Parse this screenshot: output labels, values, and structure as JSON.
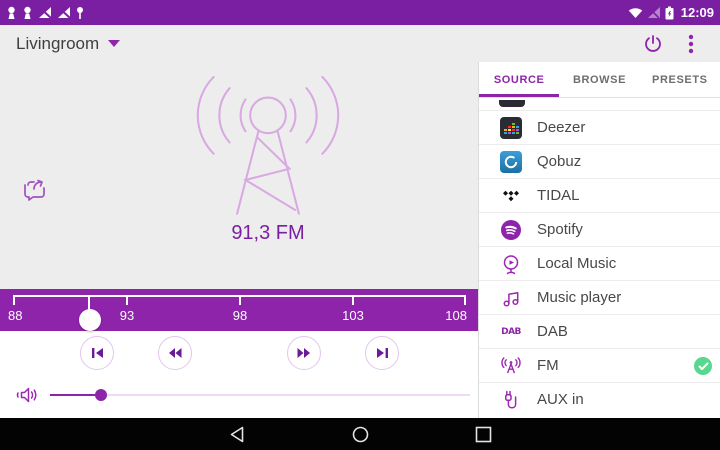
{
  "colors": {
    "status_bar": "#7B1FA2",
    "accent": "#8E24AA",
    "icon_purple": "#9C27B0",
    "antenna": "#D9A9E2",
    "selected_check": "#57D78F"
  },
  "status_bar": {
    "time": "12:09",
    "left_icons": [
      "app-notification-icon",
      "app-notification-icon",
      "wifi-off-notification-icon",
      "wifi-off-notification-icon",
      "pin-notification-icon"
    ],
    "right_icons": [
      "wifi-icon",
      "cell-signal-off-icon",
      "battery-icon"
    ]
  },
  "app_bar": {
    "room_name": "Livingroom",
    "actions": [
      "power-icon",
      "overflow-menu-icon"
    ]
  },
  "player": {
    "station_label": "91,3 FM",
    "frequency_value": 91.3,
    "frequency_min": 88,
    "frequency_max": 108,
    "frequency_ticks": [
      "88",
      "93",
      "98",
      "103",
      "108"
    ],
    "transport_buttons": [
      "skip-previous",
      "rewind",
      "fast-forward",
      "skip-next"
    ],
    "volume_level_percent": 12
  },
  "tabs": [
    {
      "label": "SOURCE",
      "active": true
    },
    {
      "label": "BROWSE",
      "active": false
    },
    {
      "label": "PRESETS",
      "active": false
    }
  ],
  "source_list": [
    {
      "label": "Deezer",
      "icon": "deezer-icon",
      "selected": false
    },
    {
      "label": "Qobuz",
      "icon": "qobuz-icon",
      "selected": false
    },
    {
      "label": "TIDAL",
      "icon": "tidal-icon",
      "selected": false
    },
    {
      "label": "Spotify",
      "icon": "spotify-icon",
      "selected": false
    },
    {
      "label": "Local Music",
      "icon": "local-music-icon",
      "selected": false
    },
    {
      "label": "Music player",
      "icon": "music-player-icon",
      "selected": false
    },
    {
      "label": "DAB",
      "icon": "dab-icon",
      "selected": false
    },
    {
      "label": "FM",
      "icon": "fm-icon",
      "selected": true
    },
    {
      "label": "AUX in",
      "icon": "aux-icon",
      "selected": false
    }
  ],
  "icons": {
    "dab_text": "DAB"
  },
  "nav_bar": {
    "icons": [
      "back-icon",
      "home-icon",
      "recents-icon"
    ]
  }
}
